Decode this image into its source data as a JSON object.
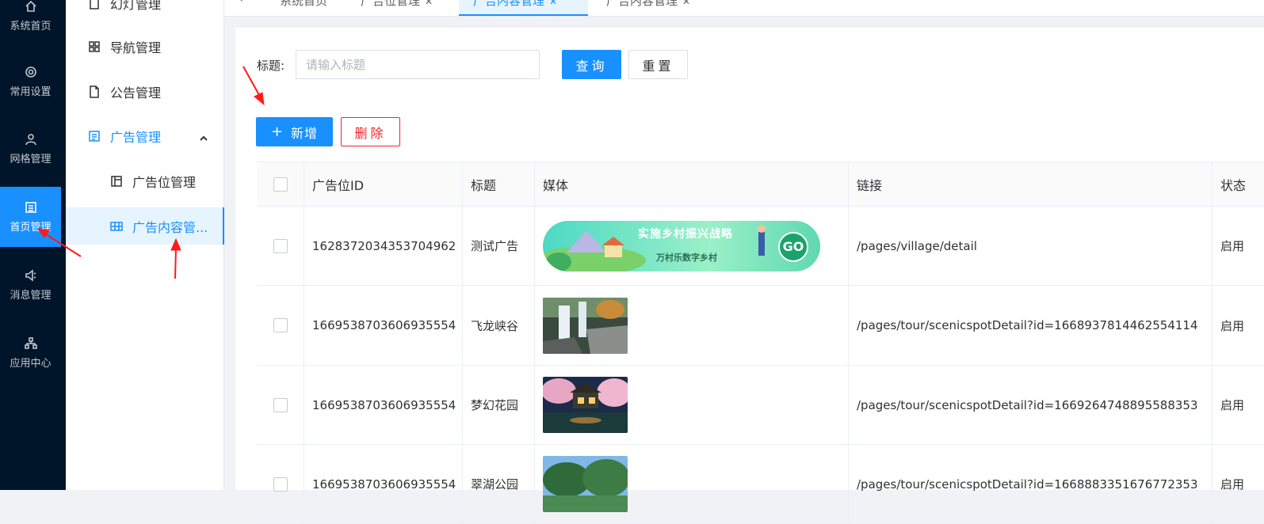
{
  "rail": {
    "items": [
      {
        "label": "系统首页",
        "icon": "home-icon"
      },
      {
        "label": "常用设置",
        "icon": "gear-icon"
      },
      {
        "label": "网格管理",
        "icon": "user-icon"
      },
      {
        "label": "首页管理",
        "icon": "image-icon"
      },
      {
        "label": "消息管理",
        "icon": "speaker-icon"
      },
      {
        "label": "应用中心",
        "icon": "apps-icon"
      }
    ],
    "active_index": 3,
    "active_color": "#1890ff",
    "background": "#001529"
  },
  "submenu": {
    "items": [
      {
        "label": "幻灯管理",
        "icon": "file-icon"
      },
      {
        "label": "导航管理",
        "icon": "grid-icon"
      },
      {
        "label": "公告管理",
        "icon": "document-icon"
      },
      {
        "label": "广告管理",
        "icon": "list-icon"
      },
      {
        "label": "广告位管理",
        "icon": "layout-icon"
      },
      {
        "label": "广告内容管...",
        "icon": "table-icon"
      }
    ],
    "selected": "广告内容管..."
  },
  "tabs": [
    {
      "label": "系统首页"
    },
    {
      "label": "广告位管理"
    },
    {
      "label": "广告内容管理"
    },
    {
      "label": "广告内容管理"
    }
  ],
  "filter": {
    "label": "标题:",
    "placeholder": "请输入标题",
    "value": "",
    "query_label": "查询",
    "reset_label": "重置"
  },
  "actions": {
    "add_label": "新增",
    "delete_label": "删除"
  },
  "table": {
    "columns": [
      "广告位ID",
      "标题",
      "媒体",
      "链接",
      "状态"
    ],
    "rows": [
      {
        "id": "1628372034353704962",
        "title": "测试广告",
        "media": "banner",
        "link": "/pages/village/detail",
        "status": "启用"
      },
      {
        "id": "1669538703606935554",
        "title": "飞龙峡谷",
        "media": "waterfall",
        "link": "/pages/tour/scenicspotDetail?id=1668937814462554114",
        "status": "启用"
      },
      {
        "id": "1669538703606935554",
        "title": "梦幻花园",
        "media": "garden",
        "link": "/pages/tour/scenicspotDetail?id=1669264748895588353",
        "status": "启用"
      },
      {
        "id": "1669538703606935554",
        "title": "翠湖公园",
        "media": "park",
        "link": "/pages/tour/scenicspotDetail?id=1668883351676772353",
        "status": "启用"
      }
    ]
  },
  "banner": {
    "title": "实施乡村振兴战略",
    "subtitle": "万村乐数字乡村",
    "go": "GO"
  },
  "colors": {
    "primary": "#1890ff",
    "danger": "#f5222d",
    "annotation": "#ff1a1a"
  }
}
